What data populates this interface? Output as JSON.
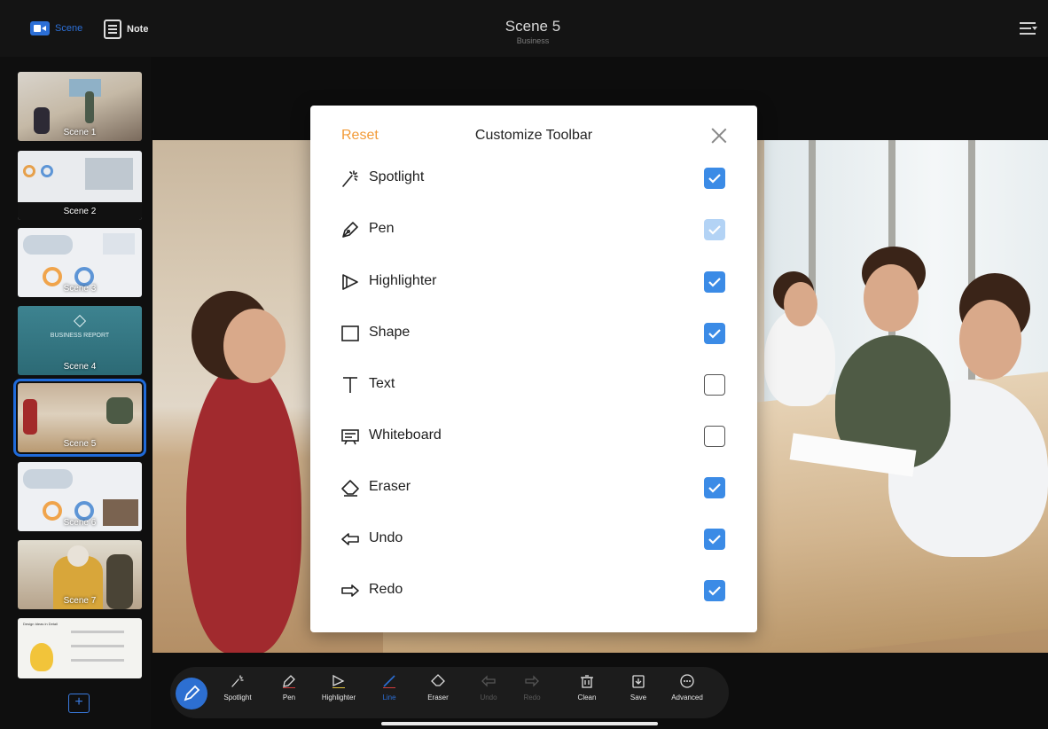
{
  "topbar": {
    "scene_mode_label": "Scene",
    "note_mode_label": "Note",
    "title": "Scene 5",
    "subtitle": "Business"
  },
  "sidebar": {
    "scenes": [
      {
        "label": "Scene 1"
      },
      {
        "label": "Scene 2"
      },
      {
        "label": "Scene 3"
      },
      {
        "label": "Scene 4",
        "caption": "BUSINESS REPORT"
      },
      {
        "label": "Scene 5",
        "active": true
      },
      {
        "label": "Scene 6"
      },
      {
        "label": "Scene 7"
      },
      {
        "label": "",
        "caption": "Design Ideas in Detail"
      }
    ],
    "add_label": "+"
  },
  "modal": {
    "reset_label": "Reset",
    "title": "Customize Toolbar",
    "items": [
      {
        "label": "Spotlight",
        "icon": "spotlight-icon",
        "state": "checked"
      },
      {
        "label": "Pen",
        "icon": "pen-icon",
        "state": "checked-disabled"
      },
      {
        "label": "Highlighter",
        "icon": "highlighter-icon",
        "state": "checked"
      },
      {
        "label": "Shape",
        "icon": "shape-icon",
        "state": "checked"
      },
      {
        "label": "Text",
        "icon": "text-icon",
        "state": "unchecked"
      },
      {
        "label": "Whiteboard",
        "icon": "whiteboard-icon",
        "state": "unchecked"
      },
      {
        "label": "Eraser",
        "icon": "eraser-icon",
        "state": "checked"
      },
      {
        "label": "Undo",
        "icon": "undo-icon",
        "state": "checked"
      },
      {
        "label": "Redo",
        "icon": "redo-icon",
        "state": "checked"
      }
    ]
  },
  "toolbar": {
    "tools": [
      {
        "label": "Spotlight"
      },
      {
        "label": "Pen"
      },
      {
        "label": "Highlighter"
      },
      {
        "label": "Line"
      },
      {
        "label": "Eraser"
      },
      {
        "label": "Undo"
      },
      {
        "label": "Redo"
      },
      {
        "label": "Clean"
      },
      {
        "label": "Save"
      },
      {
        "label": "Advanced"
      }
    ]
  },
  "colors": {
    "accent": "#2c6fd6",
    "reset": "#f29b38",
    "checkbox": "#3b8be6"
  }
}
